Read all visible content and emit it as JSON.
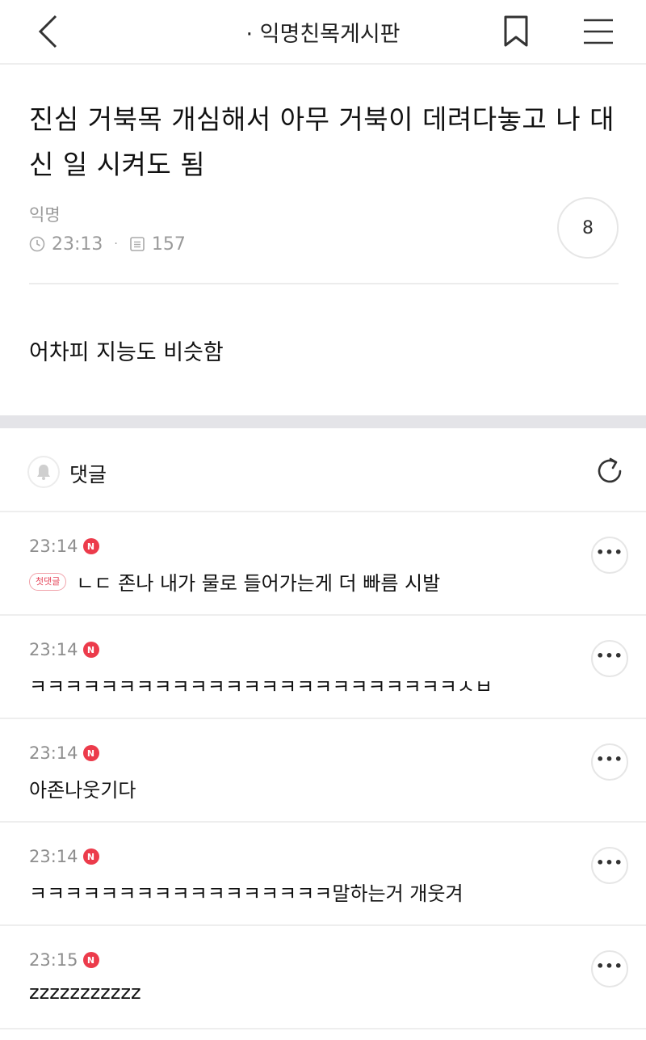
{
  "header": {
    "board_title": "· 익명친목게시판"
  },
  "post": {
    "title": "진심 거북목 개심해서 아무 거북이 데려다놓고 나 대신 일 시켜도 됨",
    "author": "익명",
    "time": "23:13",
    "views": "157",
    "comment_count": "8",
    "body": "어차피 지능도 비슷함"
  },
  "comments_section": {
    "label": "댓글"
  },
  "comments": [
    {
      "time": "23:14",
      "badge": "N",
      "tag": "첫댓글",
      "text": "ㄴㄷ 존나 내가 물로 들어가는게 더 빠름 시발"
    },
    {
      "time": "23:14",
      "badge": "N",
      "tag": "",
      "text": "ㅋㅋㅋㅋㅋㅋㅋㅋㅋㅋㅋㅋㅋㅋㅋㅋㅋㅋㅋㅋㅋㅋㅋㅋㅅㅂ"
    },
    {
      "time": "23:14",
      "badge": "N",
      "tag": "",
      "text": "아존나웃기다"
    },
    {
      "time": "23:14",
      "badge": "N",
      "tag": "",
      "text": "ㅋㅋㅋㅋㅋㅋㅋㅋㅋㅋㅋㅋㅋㅋㅋㅋㅋ말하는거 개웃겨"
    },
    {
      "time": "23:15",
      "badge": "N",
      "tag": "",
      "text": "zzzzzzzzzzz"
    }
  ],
  "colors": {
    "accent_red": "#ec3b4b",
    "muted_text": "#9a9a9a",
    "separator": "#e4e4e8"
  },
  "icons": {
    "back": "chevron-left-icon",
    "bookmark": "bookmark-icon",
    "menu": "hamburger-menu-icon",
    "clock": "clock-icon",
    "views": "document-icon",
    "bell": "bell-icon",
    "refresh": "refresh-icon",
    "more": "more-dots-icon"
  }
}
